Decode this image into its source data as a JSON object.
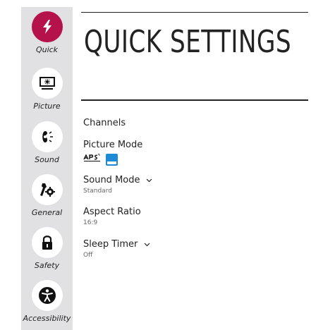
{
  "sidebar": {
    "items": [
      {
        "label": "Quick",
        "icon": "lightning-icon",
        "active": true
      },
      {
        "label": "Picture",
        "icon": "picture-icon",
        "active": false
      },
      {
        "label": "Sound",
        "icon": "sound-icon",
        "active": false
      },
      {
        "label": "General",
        "icon": "general-icon",
        "active": false
      },
      {
        "label": "Safety",
        "icon": "lock-icon",
        "active": false
      },
      {
        "label": "Accessibility",
        "icon": "accessibility-icon",
        "active": false
      }
    ]
  },
  "main": {
    "title": "QUICK SETTINGS",
    "menu": [
      {
        "label": "Channels"
      },
      {
        "label": "Picture Mode",
        "badges": [
          "aps-logo",
          "energy-star-logo"
        ]
      },
      {
        "label": "Sound Mode",
        "value": "Standard",
        "has_dropdown": true
      },
      {
        "label": "Aspect Ratio",
        "value": "16:9"
      },
      {
        "label": "Sleep Timer",
        "value": "Off",
        "has_dropdown": true
      }
    ]
  },
  "colors": {
    "accent": "#b5114b",
    "sidebar_bg": "#e1e1e3",
    "text": "#222222",
    "energy_star": "#1e8ad6"
  }
}
